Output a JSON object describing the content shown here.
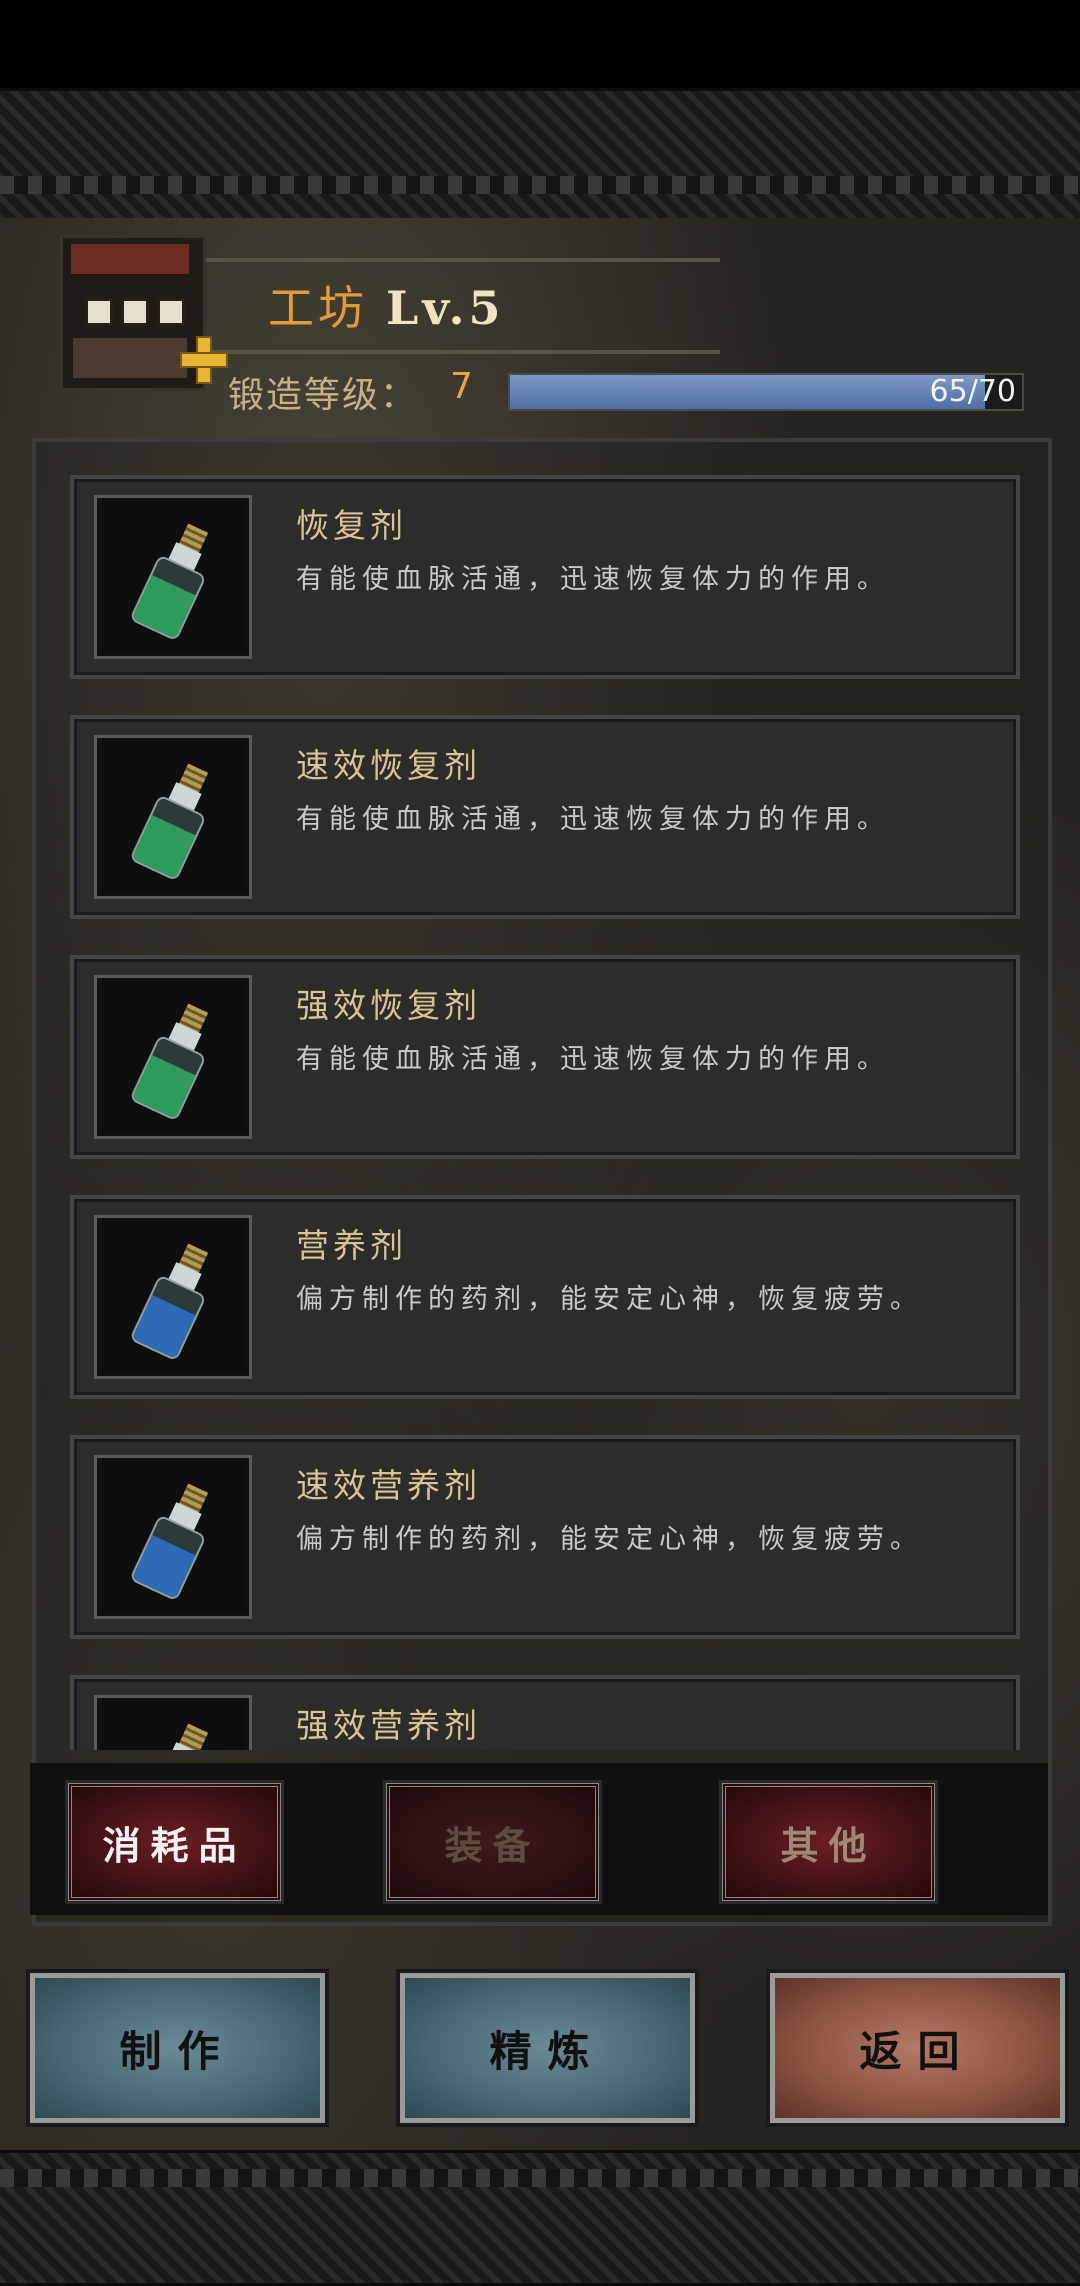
{
  "header": {
    "title": "工坊",
    "level": "Lv.5",
    "forge_label": "锻造等级：",
    "forge_value": "7",
    "progress_text": "65/70",
    "progress_fraction": 0.9286
  },
  "items": [
    {
      "name": "恢复剂",
      "desc": "有能使血脉活通，迅速恢复体力的作用。",
      "liquid_color": "#2f9b5e"
    },
    {
      "name": "速效恢复剂",
      "desc": "有能使血脉活通，迅速恢复体力的作用。",
      "liquid_color": "#2f9b5e"
    },
    {
      "name": "强效恢复剂",
      "desc": "有能使血脉活通，迅速恢复体力的作用。",
      "liquid_color": "#2f9b5e"
    },
    {
      "name": "营养剂",
      "desc": "偏方制作的药剂，能安定心神，恢复疲劳。",
      "liquid_color": "#2f6ab5"
    },
    {
      "name": "速效营养剂",
      "desc": "偏方制作的药剂，能安定心神，恢复疲劳。",
      "liquid_color": "#2f6ab5"
    },
    {
      "name": "强效营养剂",
      "desc": "",
      "liquid_color": "#2f6ab5"
    }
  ],
  "tabs": [
    "消耗品",
    "装备",
    "其他"
  ],
  "buttons": {
    "make": "制作",
    "refine": "精炼",
    "back": "返回"
  },
  "colors": {
    "accent": "#e39a3a",
    "progress": "#6784b5",
    "tab_active": "#6b1e24"
  }
}
